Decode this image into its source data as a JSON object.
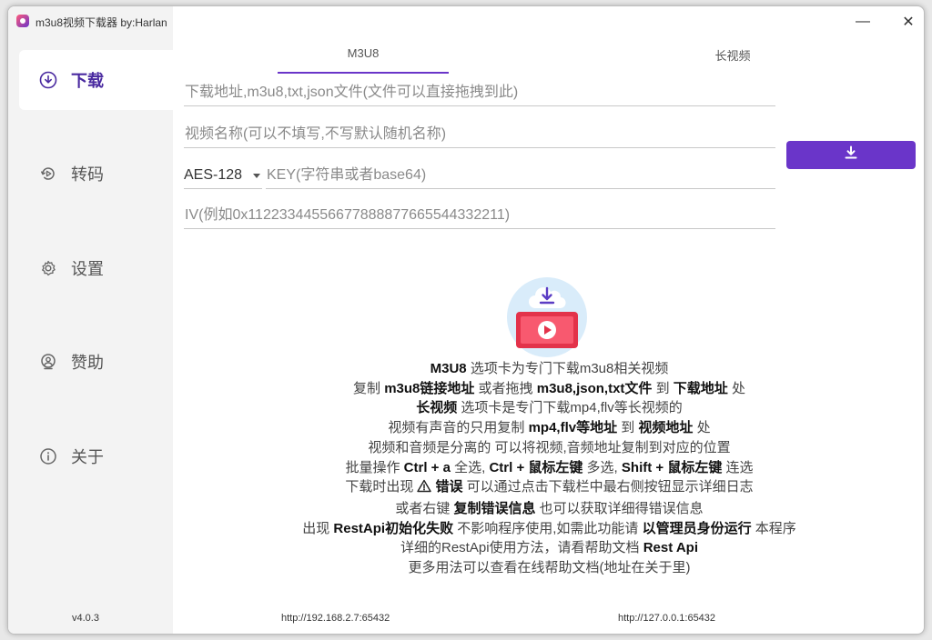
{
  "app": {
    "title": "m3u8视频下载器 by:Harlan",
    "version": "v4.0.3"
  },
  "window_controls": {
    "minimize": "—",
    "close": "✕"
  },
  "sidebar": {
    "items": [
      {
        "label": "下载",
        "icon": "download-icon",
        "active": true
      },
      {
        "label": "转码",
        "icon": "convert-icon",
        "active": false
      },
      {
        "label": "设置",
        "icon": "gear-icon",
        "active": false
      },
      {
        "label": "赞助",
        "icon": "sponsor-icon",
        "active": false
      },
      {
        "label": "关于",
        "icon": "info-icon",
        "active": false
      }
    ]
  },
  "tabs": [
    {
      "label": "M3U8",
      "active": true
    },
    {
      "label": "长视频",
      "active": false
    }
  ],
  "form": {
    "url_placeholder": "下载地址,m3u8,txt,json文件(文件可以直接拖拽到此)",
    "name_placeholder": "视频名称(可以不填写,不写默认随机名称)",
    "encryption_selected": "AES-128",
    "key_placeholder": "KEY(字符串或者base64)",
    "iv_placeholder": "IV(例如0x11223344556677888877665544332211)",
    "download_button_icon": "download-icon"
  },
  "help": {
    "l1": {
      "a": "M3U8",
      "b": " 选项卡为专门下载m3u8相关视频"
    },
    "l2": {
      "a": "复制 ",
      "b": "m3u8链接地址",
      "c": " 或者拖拽 ",
      "d": "m3u8,json,txt文件",
      "e": " 到 ",
      "f": "下载地址",
      "g": " 处"
    },
    "l3": {
      "a": "长视频",
      "b": " 选项卡是专门下载mp4,flv等长视频的"
    },
    "l4": {
      "a": "视频有声音的只用复制 ",
      "b": "mp4,flv等地址",
      "c": " 到 ",
      "d": "视频地址",
      "e": " 处"
    },
    "l5": "视频和音频是分离的 可以将视频,音频地址复制到对应的位置",
    "l6": {
      "a": "批量操作 ",
      "b": "Ctrl + a",
      "c": " 全选, ",
      "d": "Ctrl + 鼠标左键",
      "e": " 多选, ",
      "f": "Shift + 鼠标左键",
      "g": " 连选"
    },
    "l7": {
      "a": "下载时出现 ",
      "icon": "warning-icon",
      "b": "错误",
      "c": " 可以通过点击下载栏中最右侧按钮显示详细日志"
    },
    "l8": {
      "a": "或者右键 ",
      "b": "复制错误信息",
      "c": " 也可以获取详细得错误信息"
    },
    "l9": {
      "a": "出现 ",
      "b": "RestApi初始化失败",
      "c": " 不影响程序使用,如需此功能请 ",
      "d": "以管理员身份运行",
      "e": " 本程序"
    },
    "l10": {
      "a": "详细的RestApi使用方法，请看帮助文档 ",
      "b": "Rest Api"
    },
    "l11": "更多用法可以查看在线帮助文档(地址在关于里)"
  },
  "footer": {
    "lan_url": "http://192.168.2.7:65432",
    "local_url": "http://127.0.0.1:65432"
  },
  "colors": {
    "accent": "#6a35c9",
    "sidebar_bg": "#f3f3f3"
  }
}
